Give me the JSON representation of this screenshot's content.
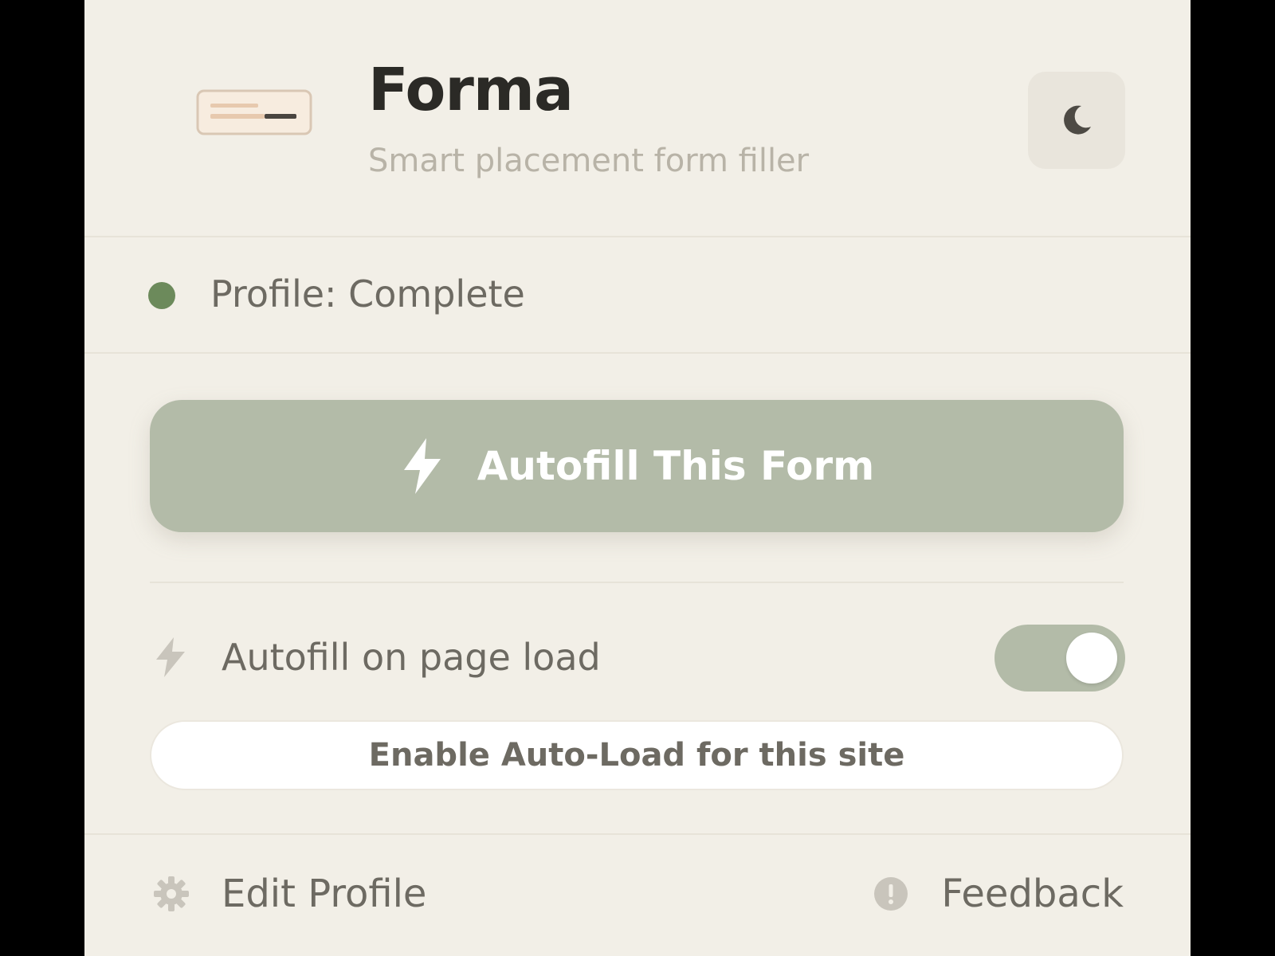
{
  "header": {
    "title": "Forma",
    "subtitle": "Smart placement form filler",
    "logo_icon": "form-card-icon",
    "theme_toggle_icon": "moon-icon"
  },
  "status": {
    "text": "Profile: Complete",
    "indicator_color": "#6c8a5b"
  },
  "primary_action": {
    "label": "Autofill This Form",
    "icon": "bolt-icon",
    "color": "#b3bba8"
  },
  "auto_load": {
    "label": "Autofill on page load",
    "icon": "bolt-icon",
    "enabled": true,
    "enable_site_button": "Enable Auto-Load for this site"
  },
  "footer": {
    "edit_profile_label": "Edit Profile",
    "edit_profile_icon": "gear-icon",
    "feedback_label": "Feedback",
    "feedback_icon": "alert-circle-icon"
  },
  "colors": {
    "background": "#f2efe7",
    "accent": "#b3bba8",
    "text": "#6d6a62",
    "title": "#2b2a26"
  }
}
